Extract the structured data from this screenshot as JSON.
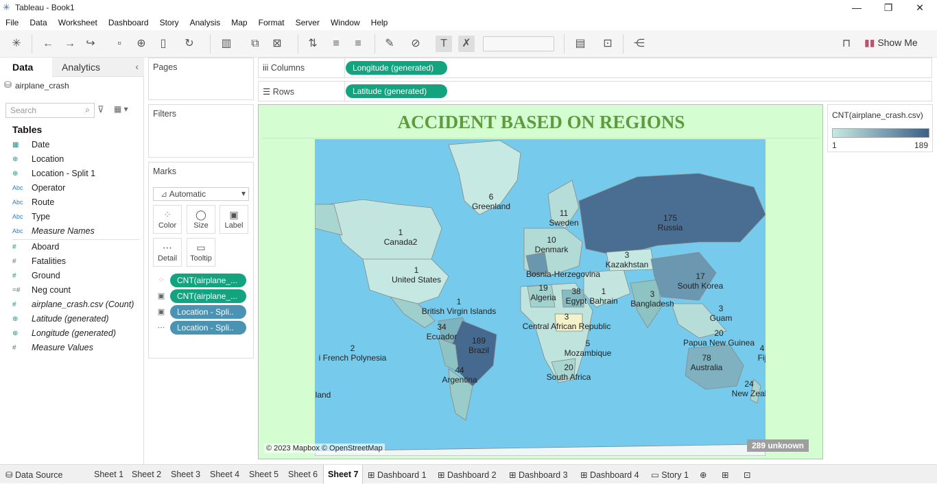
{
  "window": {
    "title": "Tableau - Book1",
    "minimize": "—",
    "restore": "❐",
    "close": "✕"
  },
  "menu": [
    "File",
    "Data",
    "Worksheet",
    "Dashboard",
    "Story",
    "Analysis",
    "Map",
    "Format",
    "Server",
    "Window",
    "Help"
  ],
  "toolbar": {
    "show_me_label": "Show Me"
  },
  "left_pane": {
    "tab_data": "Data",
    "tab_analytics": "Analytics",
    "datasource": "airplane_crash",
    "search_placeholder": "Search",
    "tables_heading": "Tables",
    "dimensions": [
      {
        "icon": "calendar-icon",
        "label": "Date"
      },
      {
        "icon": "globe-icon",
        "label": "Location"
      },
      {
        "icon": "globe-icon",
        "label": "Location - Split 1"
      },
      {
        "icon": "abc-icon",
        "label": "Operator"
      },
      {
        "icon": "abc-icon",
        "label": "Route"
      },
      {
        "icon": "abc-icon",
        "label": "Type"
      },
      {
        "icon": "abc-icon",
        "label": "Measure Names"
      }
    ],
    "measures": [
      {
        "icon": "hash-icon",
        "label": "Aboard"
      },
      {
        "icon": "hash-icon",
        "label": "Fatalities"
      },
      {
        "icon": "hash-icon",
        "label": "Ground"
      },
      {
        "icon": "hash-icon",
        "label": "Neg count"
      },
      {
        "icon": "hash-icon",
        "label": "airplane_crash.csv (Count)"
      },
      {
        "icon": "globe-icon",
        "label": "Latitude (generated)"
      },
      {
        "icon": "globe-icon",
        "label": "Longitude (generated)"
      },
      {
        "icon": "hash-icon",
        "label": "Measure Values"
      }
    ]
  },
  "cards": {
    "pages": "Pages",
    "filters": "Filters",
    "marks": "Marks",
    "marks_type": "Automatic",
    "mark_buttons": [
      "Color",
      "Size",
      "Label",
      "Detail",
      "Tooltip"
    ],
    "mark_pills": [
      "CNT(airplane_...",
      "CNT(airplane_...",
      "Location - Spli..",
      "Location - Spli.."
    ]
  },
  "shelves": {
    "columns_label": "Columns",
    "columns_pill": "Longitude (generated)",
    "rows_label": "Rows",
    "rows_pill": "Latitude (generated)"
  },
  "viz": {
    "title": "ACCIDENT BASED ON REGIONS",
    "credit": "© 2023 Mapbox © OpenStreetMap",
    "unknown": "289 unknown",
    "map_labels": [
      {
        "count": "6",
        "name": "Greenland"
      },
      {
        "count": "11",
        "name": "Sweden"
      },
      {
        "count": "175",
        "name": "Russia"
      },
      {
        "count": "1",
        "name": "Canada2"
      },
      {
        "count": "10",
        "name": "Denmark"
      },
      {
        "count": "3",
        "name": "Kazakhstan"
      },
      {
        "count": "1",
        "name": "United States"
      },
      {
        "count": "",
        "name": "Bosnia-Herzegovina"
      },
      {
        "count": "17",
        "name": "South Korea"
      },
      {
        "count": "19",
        "name": "Algeria"
      },
      {
        "count": "38",
        "name": "Egypt"
      },
      {
        "count": "1",
        "name": "Bahrain"
      },
      {
        "count": "3",
        "name": "Bangladesh"
      },
      {
        "count": "1",
        "name": "British Virgin Islands"
      },
      {
        "count": "3",
        "name": "Guam"
      },
      {
        "count": "3",
        "name": "Central African Republic"
      },
      {
        "count": "34",
        "name": "Ecuador"
      },
      {
        "count": "189",
        "name": "Brazil"
      },
      {
        "count": "20",
        "name": "Papua New Guinea"
      },
      {
        "count": "2",
        "name": "i French Polynesia"
      },
      {
        "count": "5",
        "name": "Mozambique"
      },
      {
        "count": "78",
        "name": "Australia"
      },
      {
        "count": "4",
        "name": "Fij"
      },
      {
        "count": "44",
        "name": "Argentina"
      },
      {
        "count": "20",
        "name": "South Africa"
      },
      {
        "count": "24",
        "name": "New Zeal"
      },
      {
        "count": "",
        "name": "land"
      }
    ]
  },
  "legend": {
    "title": "CNT(airplane_crash.csv)",
    "min": "1",
    "max": "189",
    "color_low": "#c7e9e3",
    "color_high": "#3a5f86"
  },
  "tabs": [
    "Data Source",
    "Sheet 1",
    "Sheet 2",
    "Sheet 3",
    "Sheet 4",
    "Sheet 5",
    "Sheet 6",
    "Sheet 7",
    "Dashboard 1",
    "Dashboard 2",
    "Dashboard 3",
    "Dashboard 4",
    "Story 1"
  ],
  "active_tab": "Sheet 7"
}
